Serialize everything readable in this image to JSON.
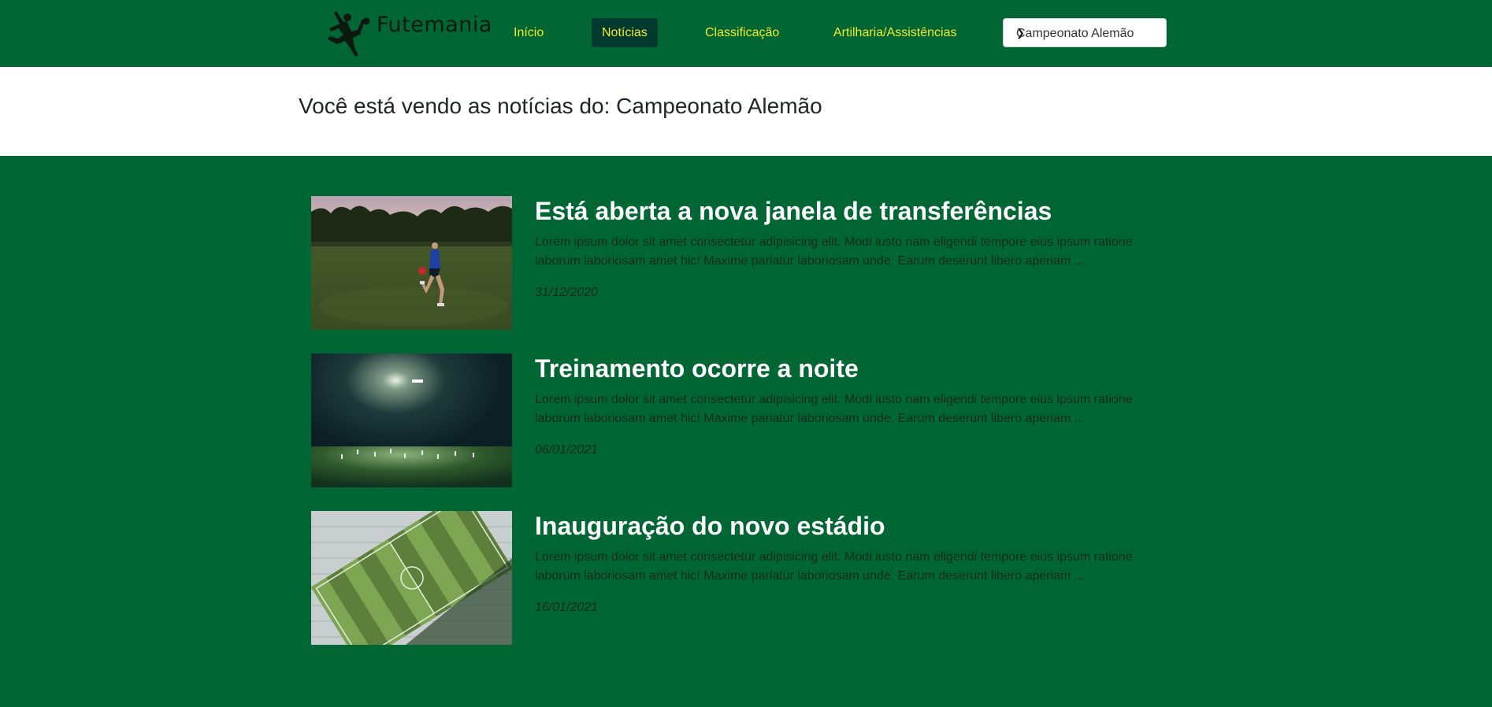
{
  "nav": {
    "brand": "Futemania",
    "links": [
      {
        "label": "Início",
        "active": false
      },
      {
        "label": "Notícias",
        "active": true
      },
      {
        "label": "Classificação",
        "active": false
      },
      {
        "label": "Artilharia/Assistências",
        "active": false
      }
    ],
    "league_select": {
      "value": "Campeonato Alemão"
    }
  },
  "page": {
    "title": "Você está vendo as notícias do: Campeonato Alemão"
  },
  "news": [
    {
      "title": "Está aberta a nova janela de transferências",
      "text": "Lorem ipsum dolor sit amet consectetur adipisicing elit. Modi iusto nam eligendi tempore eius ipsum ratione laborum laboriosam amet hic! Maxime pariatur laboriosam unde. Earum deserunt libero aperiam ...",
      "date": "31/12/2020",
      "image": "player-juggling-ball-photo"
    },
    {
      "title": "Treinamento ocorre a noite",
      "text": "Lorem ipsum dolor sit amet consectetur adipisicing elit. Modi iusto nam eligendi tempore eius ipsum ratione laborum laboriosam amet hic! Maxime pariatur laboriosam unde. Earum deserunt libero aperiam ...",
      "date": "06/01/2021",
      "image": "night-training-photo"
    },
    {
      "title": "Inauguração do novo estádio",
      "text": "Lorem ipsum dolor sit amet consectetur adipisicing elit. Modi iusto nam eligendi tempore eius ipsum ratione laborum laboriosam amet hic! Maxime pariatur laboriosam unde. Earum deserunt libero aperiam ...",
      "date": "16/01/2021",
      "image": "stadium-aerial-photo"
    }
  ],
  "colors": {
    "brand_green": "#006633",
    "nav_link": "#f2ea2a",
    "active_bg": "#003a2e"
  }
}
